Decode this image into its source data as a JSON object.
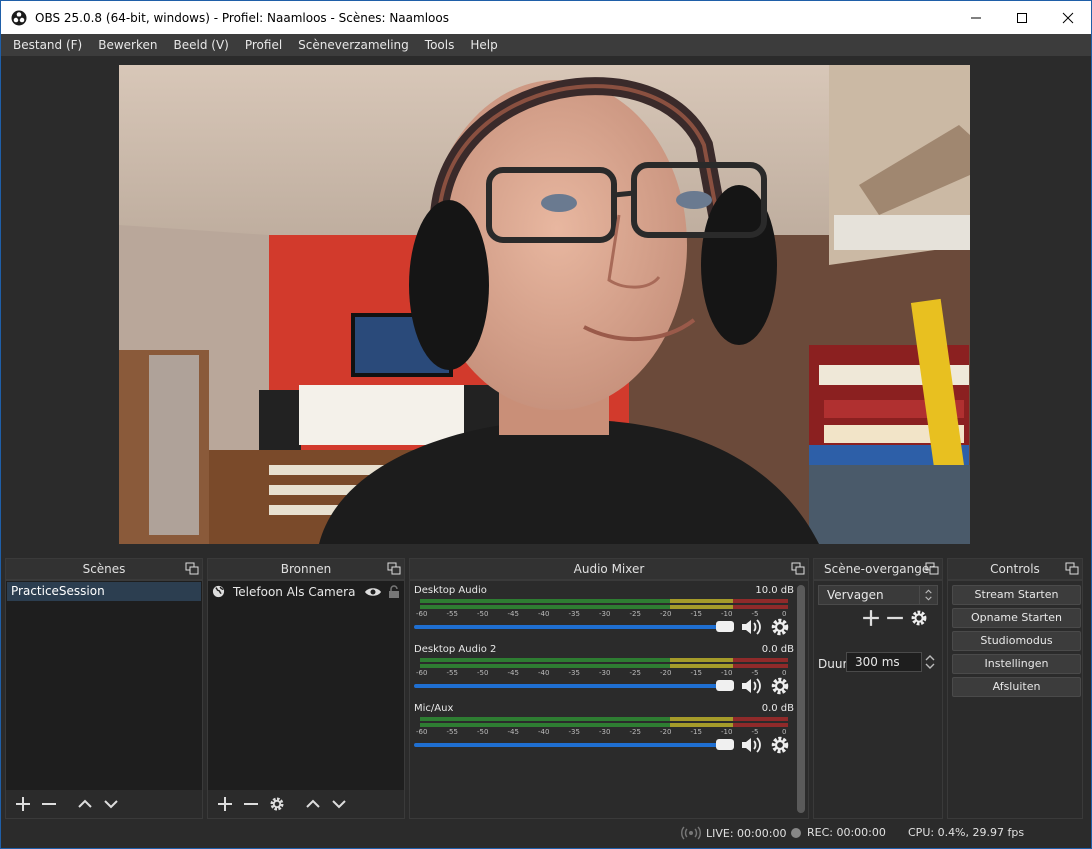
{
  "window": {
    "title": "OBS 25.0.8 (64-bit, windows) - Profiel: Naamloos - Scènes: Naamloos"
  },
  "menu": [
    "Bestand (F)",
    "Bewerken",
    "Beeld (V)",
    "Profiel",
    "Scèneverzameling",
    "Tools",
    "Help"
  ],
  "docks": {
    "scenes": {
      "title": "Scènes",
      "items": [
        "PracticeSession"
      ]
    },
    "sources": {
      "title": "Bronnen",
      "items": [
        {
          "label": "Telefoon Als Camera",
          "icon": "globe-icon"
        }
      ]
    },
    "mixer": {
      "title": "Audio Mixer",
      "channels": [
        {
          "name": "Desktop Audio",
          "db": "10.0 dB"
        },
        {
          "name": "Desktop Audio 2",
          "db": "0.0 dB"
        },
        {
          "name": "Mic/Aux",
          "db": "0.0 dB"
        }
      ],
      "ticks": [
        "-60",
        "-55",
        "-50",
        "-45",
        "-40",
        "-35",
        "-30",
        "-25",
        "-20",
        "-15",
        "-10",
        "-5",
        "0"
      ]
    },
    "transitions": {
      "title": "Scène-overgangen",
      "selected": "Vervagen",
      "duration_label": "Duur",
      "duration_value": "300 ms"
    },
    "controls": {
      "title": "Controls",
      "buttons": [
        "Stream Starten",
        "Opname Starten",
        "Studiomodus",
        "Instellingen",
        "Afsluiten"
      ]
    }
  },
  "status": {
    "live": "LIVE: 00:00:00",
    "rec": "REC: 00:00:00",
    "cpu": "CPU: 0.4%, 29.97 fps"
  },
  "colors": {
    "accent": "#1f6fd1",
    "selection": "#2c3e50",
    "panel": "#2b2b2b"
  }
}
